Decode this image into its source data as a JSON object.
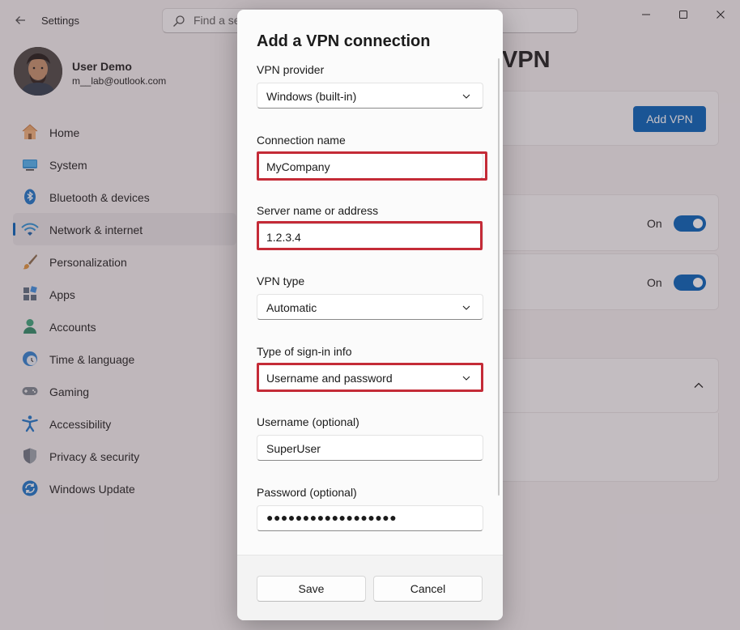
{
  "app": {
    "title": "Settings"
  },
  "search": {
    "value": "Find a se",
    "placeholder": "Find a setting"
  },
  "profile": {
    "name": "User Demo",
    "email": "m__lab@outlook.com"
  },
  "sidebar": {
    "items": [
      {
        "label": "Home",
        "icon": "home-icon"
      },
      {
        "label": "System",
        "icon": "system-icon"
      },
      {
        "label": "Bluetooth & devices",
        "icon": "bluetooth-icon"
      },
      {
        "label": "Network & internet",
        "icon": "wifi-icon",
        "active": true
      },
      {
        "label": "Personalization",
        "icon": "brush-icon"
      },
      {
        "label": "Apps",
        "icon": "apps-icon"
      },
      {
        "label": "Accounts",
        "icon": "accounts-icon"
      },
      {
        "label": "Time & language",
        "icon": "clock-globe-icon"
      },
      {
        "label": "Gaming",
        "icon": "gamepad-icon"
      },
      {
        "label": "Accessibility",
        "icon": "accessibility-icon"
      },
      {
        "label": "Privacy & security",
        "icon": "shield-icon"
      },
      {
        "label": "Windows Update",
        "icon": "update-icon"
      }
    ]
  },
  "main": {
    "heading": "VPN",
    "add_vpn_label": "Add VPN",
    "toggles": [
      {
        "label": "On",
        "state": true
      },
      {
        "label": "On",
        "state": true
      }
    ]
  },
  "dialog": {
    "title": "Add a VPN connection",
    "fields": {
      "provider": {
        "label": "VPN provider",
        "value": "Windows (built-in)"
      },
      "connection_name": {
        "label": "Connection name",
        "value": "MyCompany"
      },
      "server": {
        "label": "Server name or address",
        "value": "1.2.3.4"
      },
      "vpn_type": {
        "label": "VPN type",
        "value": "Automatic"
      },
      "signin_type": {
        "label": "Type of sign-in info",
        "value": "Username and password"
      },
      "username": {
        "label": "Username (optional)",
        "value": "SuperUser"
      },
      "password": {
        "label": "Password (optional)",
        "value": "●●●●●●●●●●●●●●●●●●"
      }
    },
    "save_label": "Save",
    "cancel_label": "Cancel"
  },
  "colors": {
    "accent": "#005fb8",
    "highlight": "#c42b37"
  }
}
